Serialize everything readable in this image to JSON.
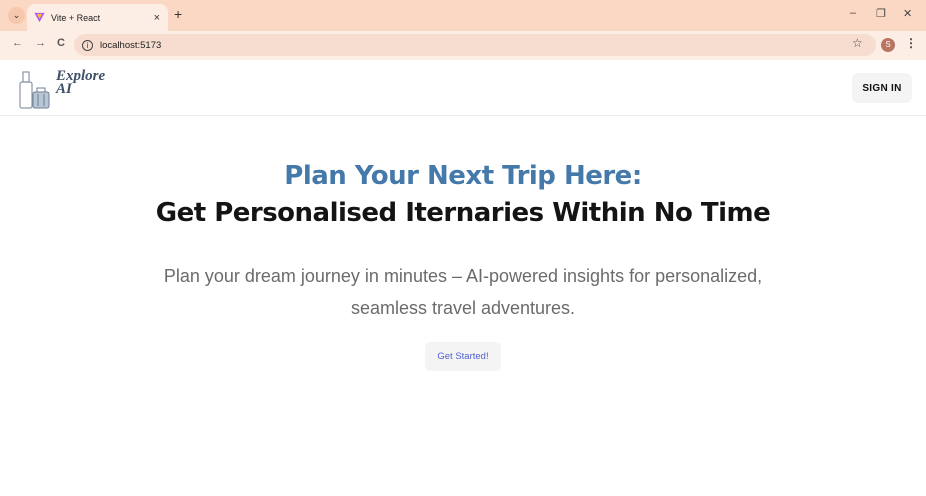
{
  "browser": {
    "tab_title": "Vite + React",
    "tab_close": "×",
    "new_tab": "+",
    "window_controls": {
      "minimize": "–",
      "restore": "❐",
      "close": "✕"
    },
    "nav": {
      "back": "←",
      "forward": "→",
      "reload": "C"
    },
    "url": "localhost:5173",
    "profile_initial": "S"
  },
  "site": {
    "logo_text_line1": "Explore",
    "logo_text_line2": "AI",
    "sign_in_label": "SIGN IN"
  },
  "hero": {
    "title_line1": "Plan Your Next Trip Here:",
    "title_line2": "Get Personalised Iternaries Within No Time",
    "subtitle": "Plan your dream journey in minutes – AI-powered insights for personalized, seamless travel adventures.",
    "cta_label": "Get Started!"
  },
  "colors": {
    "tabstrip_bg": "#fbd8c3",
    "toolbar_bg": "#fdeee5",
    "hero_accent": "#4479aa",
    "hero_dark": "#141414",
    "cta_text": "#4f5fd0"
  }
}
